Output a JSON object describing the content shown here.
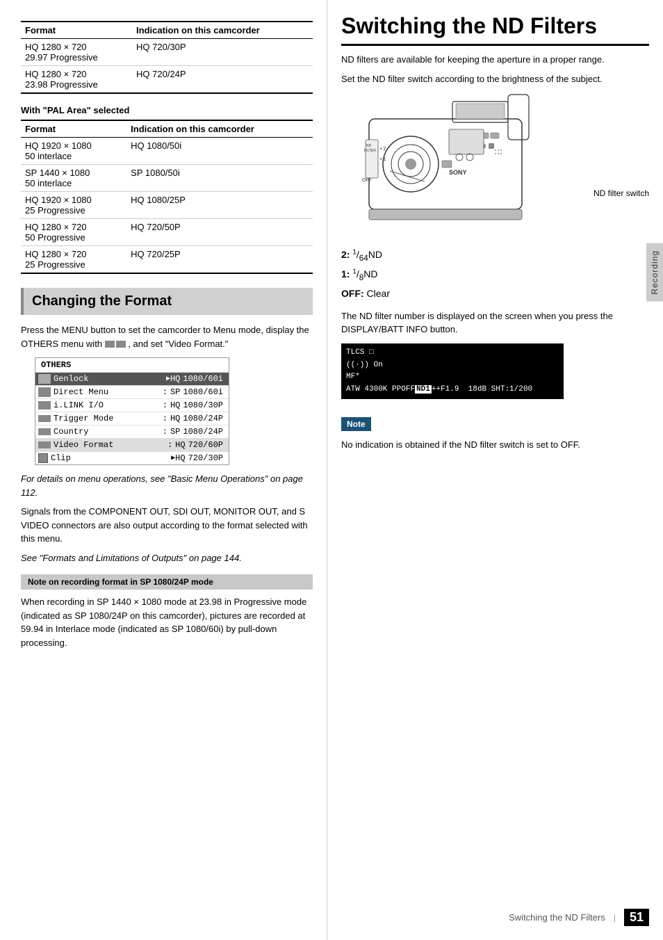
{
  "left": {
    "top_table_note": "With \"PAL Area\" selected",
    "top_tables": [
      {
        "rows": [
          {
            "format": "HQ 1280 × 720\n29.97 Progressive",
            "indication": "HQ 720/30P"
          },
          {
            "format": "HQ 1280 × 720\n23.98 Progressive",
            "indication": "HQ 720/24P"
          }
        ]
      }
    ],
    "pal_table": {
      "rows": [
        {
          "format": "HQ 1920 × 1080\n50 interlace",
          "indication": "HQ 1080/50i"
        },
        {
          "format": "SP 1440 × 1080\n50 interlace",
          "indication": "SP 1080/50i"
        },
        {
          "format": "HQ 1920 × 1080\n25 Progressive",
          "indication": "HQ 1080/25P"
        },
        {
          "format": "HQ 1280 × 720\n50 Progressive",
          "indication": "HQ 720/50P"
        },
        {
          "format": "HQ 1280 × 720\n25 Progressive",
          "indication": "HQ 720/25P"
        }
      ]
    },
    "section_title": "Changing the Format",
    "body1": "Press the MENU button to set the camcorder to Menu mode, display the OTHERS menu with",
    "body1b": ", and set \"Video Format.\"",
    "others_menu": {
      "header": "OTHERS",
      "rows": [
        {
          "icon": true,
          "label": "Genlock",
          "sep": "",
          "qual": "HQ",
          "value": "1080/60i",
          "arrow": "▶",
          "highlight": true
        },
        {
          "icon": true,
          "label": "Direct Menu",
          "sep": ":",
          "qual": "SP",
          "value": "1080/60i",
          "arrow": ""
        },
        {
          "icon": true,
          "label": "i.LINK I/O",
          "sep": ":",
          "qual": "HQ",
          "value": "1080/30P",
          "arrow": ""
        },
        {
          "icon": true,
          "label": "Trigger Mode",
          "sep": ":",
          "qual": "HQ",
          "value": "1080/24P",
          "arrow": ""
        },
        {
          "icon": true,
          "label": "Country",
          "sep": ":",
          "qual": "SP",
          "value": "1080/24P",
          "arrow": ""
        },
        {
          "icon": true,
          "label": "Video Format",
          "sep": ":",
          "qual": "HQ",
          "value": "720/60P",
          "arrow": "",
          "selected": true
        },
        {
          "icon": true,
          "label": "Clip",
          "sep": "",
          "qual": "HQ",
          "value": "720/30P",
          "arrow": "▶"
        }
      ]
    },
    "italic1": "For details on menu operations, see \"Basic Menu Operations\" on page 112.",
    "body2": "Signals from the COMPONENT OUT, SDI OUT, MONITOR OUT, and S VIDEO connectors are also output according to the format selected with this menu.",
    "italic2": "See \"Formats and Limitations of Outputs\" on page 144.",
    "note_box_label": "Note on recording format in SP 1080/24P mode",
    "body3": "When recording in SP 1440 × 1080 mode at 23.98 in Progressive mode (indicated as SP 1080/24P on this camcorder), pictures are recorded at 59.94 in Interlace mode (indicated as SP 1080/60i) by pull-down processing.",
    "when_recording": "When recording"
  },
  "right": {
    "title": "Switching the ND Filters",
    "body1": "ND filters are available for keeping the aperture in a proper range.",
    "body2": "Set the ND filter switch according to the brightness of the subject.",
    "nd_switch_label": "ND filter switch",
    "nd_label_2": "2:",
    "nd_sup_2": "1",
    "nd_sub_2": "64",
    "nd_text_2": "ND",
    "nd_label_1": "1:",
    "nd_sup_1": "1",
    "nd_sub_1": "8",
    "nd_text_1": "ND",
    "nd_off_label": "OFF:",
    "nd_off_text": "Clear",
    "body3": "The ND filter number is displayed on the screen when you press the DISPLAY/BATT INFO button.",
    "screen_lines": [
      "TLCS ⬜",
      "((·)) On",
      "MF✱",
      "ATW 4300K PPOFF ND1 ++F1.9  18dB SHT:1/200"
    ],
    "note_label": "Note",
    "note_body": "No indication is obtained if the ND filter switch is set to OFF.",
    "side_tab": "Recording"
  },
  "footer": {
    "left_text": "Switching the ND Filters",
    "page_number": "51"
  },
  "table_headers": {
    "format": "Format",
    "indication": "Indication on this camcorder"
  }
}
